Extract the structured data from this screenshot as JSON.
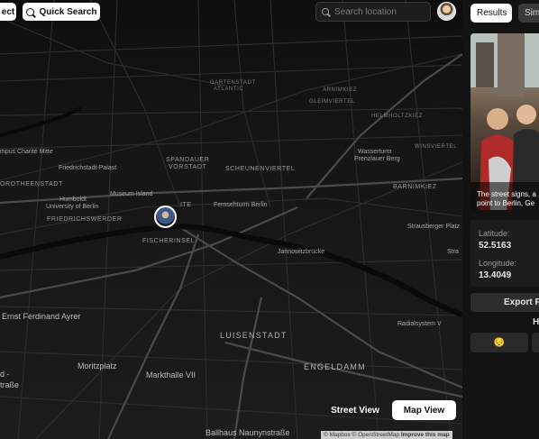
{
  "topbar": {
    "left_button_label": "ect",
    "quick_search_label": "Quick Search",
    "search_placeholder": "Search location"
  },
  "map": {
    "labels": {
      "garten": "GARTENSTADT",
      "atlantic": "ATLANTIC",
      "arnimkiez": "ARNIMKIEZ",
      "gleimviertel": "GLEIMVIERTEL",
      "helmholtzkiez": "HELMHOLTZKIEZ",
      "winsviertel": "WINSVIERTEL",
      "mpus": "mpus Charité Mitte",
      "wasserturm": "Wasserturm",
      "prenzlauer": "Prenzlauer Berg",
      "spandauer1": "SPANDAUER",
      "spandauer2": "VORSTADT",
      "friedrich_palast": "Friedrichstadt-Palast",
      "scheunenviertel": "SCHEUNENVIERTEL",
      "barnimkiez": "BARNIMKIEZ",
      "dorotheen": "OROTHEENSTADT",
      "humboldt1": "Humboldt",
      "humboldt2": "University of Berlin",
      "museum": "Museum Island",
      "fernseh": "Fernsehturm Berlin",
      "friedrichswerder": "FRIEDRICHSWERDER",
      "strausberger": "Strausberger Platz",
      "stra": "Stra",
      "fischerinsel": "FISCHERINSEL",
      "jannowitz": "Jannowitzbrücke",
      "ernst": "Ernst Ferdinand Ayrer",
      "radialsystem": "Radialsystem V",
      "luisenstadt": "LUISENSTADT",
      "moritzplatz": "Moritzplatz",
      "engeldamm": "ENGELDAMM",
      "markthalle": "Markthalle VII",
      "d": "d -",
      "strasse": "traße",
      "ballhaus": "Ballhaus Naunynstraße",
      "ite": "ITE"
    },
    "street_view_label": "Street View",
    "map_view_label": "Map View",
    "attribution": "© Mapbox © OpenStreetMap",
    "improve_label": "Improve this map"
  },
  "panel": {
    "tabs": [
      "Results",
      "Sim"
    ],
    "caption_line1": "The street signs, a",
    "caption_line2": "point to Berlin, Ge",
    "latitude_label": "Latitude:",
    "latitude_value": "52.5163",
    "longitude_label": "Longitude:",
    "longitude_value": "13.4049",
    "export_label": "Export PL",
    "rate_heading": "H",
    "rate_emoji": "😔"
  },
  "colors": {
    "map_bg": "#151515",
    "panel_bg": "#131313",
    "button_bg": "#ffffff"
  }
}
